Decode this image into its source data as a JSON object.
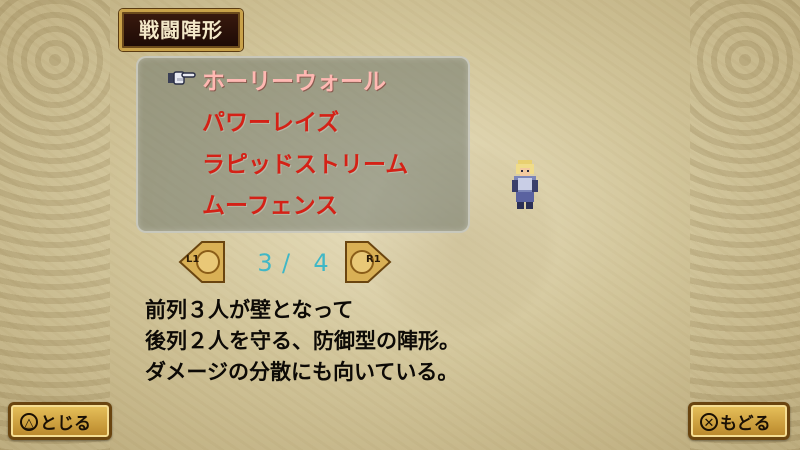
{
  "screen": {
    "title": "戦闘陣形"
  },
  "formations": {
    "items": [
      {
        "label": "ホーリーウォール",
        "selected": true
      },
      {
        "label": "パワーレイズ",
        "selected": false
      },
      {
        "label": "ラピッドストリーム",
        "selected": false
      },
      {
        "label": "ムーフェンス",
        "selected": false
      }
    ]
  },
  "pager": {
    "prev_label": "L1",
    "next_label": "R1",
    "current": "3",
    "separator": "/",
    "total": "4"
  },
  "description": {
    "lines": [
      "前列３人が壁となって",
      "後列２人を守る、防御型の陣形。",
      "ダメージの分散にも向いている。"
    ]
  },
  "buttons": {
    "close": {
      "glyph": "△",
      "label": "とじる"
    },
    "back": {
      "glyph": "✕",
      "label": "もどる"
    }
  },
  "icons": {
    "cursor": "pointing-hand-icon",
    "character": "knight-sprite"
  },
  "colors": {
    "item_text": "#d42116",
    "selected_text": "#ffb8b2",
    "page_text": "#3fb7c6"
  }
}
